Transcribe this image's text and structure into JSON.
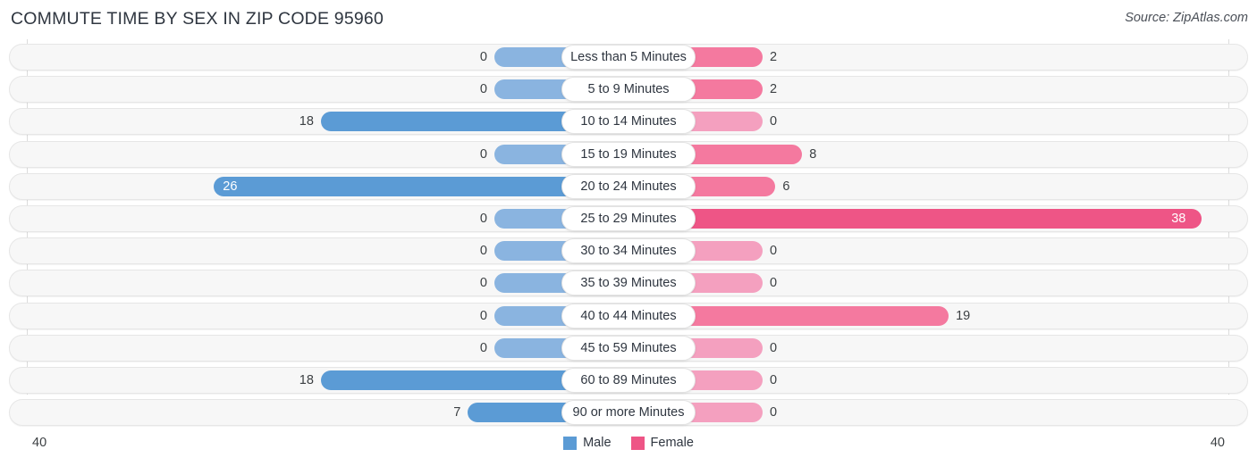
{
  "header": {
    "title": "COMMUTE TIME BY SEX IN ZIP CODE 95960",
    "source": "Source: ZipAtlas.com"
  },
  "legend": {
    "male_label": "Male",
    "female_label": "Female",
    "male_color": "#5b9bd5",
    "female_color": "#ee5586"
  },
  "axis": {
    "left_end": "40",
    "right_end": "40",
    "max": 40
  },
  "chart_data": {
    "type": "bar",
    "title": "COMMUTE TIME BY SEX IN ZIP CODE 95960",
    "subtitle": "Source: ZipAtlas.com",
    "orientation": "horizontal-diverging",
    "xlabel": "",
    "ylabel": "",
    "xlim": [
      40,
      40
    ],
    "grid": true,
    "legend_position": "bottom-center",
    "categories": [
      "Less than 5 Minutes",
      "5 to 9 Minutes",
      "10 to 14 Minutes",
      "15 to 19 Minutes",
      "20 to 24 Minutes",
      "25 to 29 Minutes",
      "30 to 34 Minutes",
      "35 to 39 Minutes",
      "40 to 44 Minutes",
      "45 to 59 Minutes",
      "60 to 89 Minutes",
      "90 or more Minutes"
    ],
    "series": [
      {
        "name": "Male",
        "color": "#5b9bd5",
        "values": [
          0,
          0,
          18,
          0,
          26,
          0,
          0,
          0,
          0,
          0,
          18,
          7
        ]
      },
      {
        "name": "Female",
        "color": "#ee5586",
        "values": [
          2,
          2,
          0,
          8,
          6,
          38,
          0,
          0,
          19,
          0,
          0,
          0
        ]
      }
    ]
  },
  "rows": [
    {
      "label": "Less than 5 Minutes",
      "male": "0",
      "female": "2"
    },
    {
      "label": "5 to 9 Minutes",
      "male": "0",
      "female": "2"
    },
    {
      "label": "10 to 14 Minutes",
      "male": "18",
      "female": "0"
    },
    {
      "label": "15 to 19 Minutes",
      "male": "0",
      "female": "8"
    },
    {
      "label": "20 to 24 Minutes",
      "male": "26",
      "female": "6"
    },
    {
      "label": "25 to 29 Minutes",
      "male": "0",
      "female": "38"
    },
    {
      "label": "30 to 34 Minutes",
      "male": "0",
      "female": "0"
    },
    {
      "label": "35 to 39 Minutes",
      "male": "0",
      "female": "0"
    },
    {
      "label": "40 to 44 Minutes",
      "male": "0",
      "female": "19"
    },
    {
      "label": "45 to 59 Minutes",
      "male": "0",
      "female": "0"
    },
    {
      "label": "60 to 89 Minutes",
      "male": "18",
      "female": "0"
    },
    {
      "label": "90 or more Minutes",
      "male": "7",
      "female": "0"
    }
  ]
}
